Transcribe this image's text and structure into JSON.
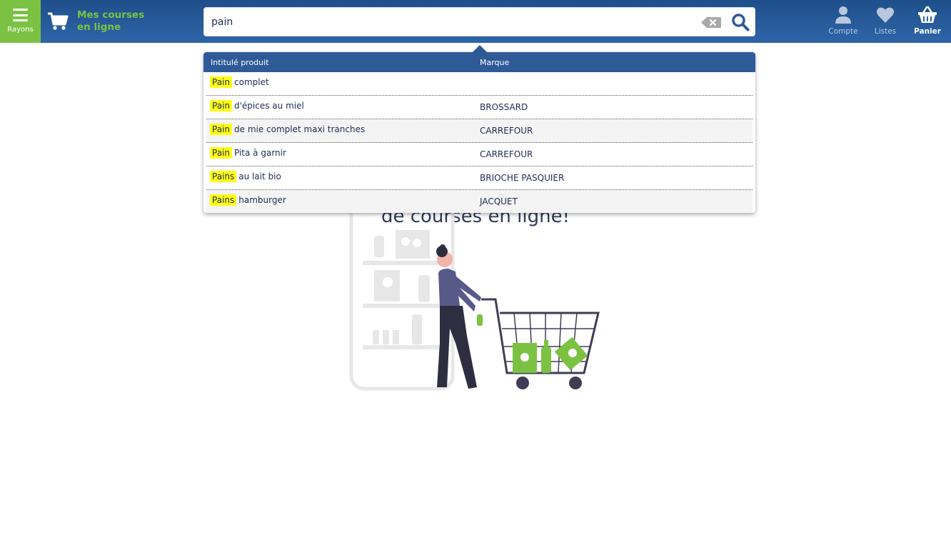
{
  "header": {
    "rayons_label": "Rayons",
    "logo_line1": "Mes courses",
    "logo_line2": "en ligne",
    "search": {
      "value": "pain",
      "placeholder": ""
    },
    "icons": [
      {
        "name": "user-icon",
        "label": "Compte"
      },
      {
        "name": "heart-icon",
        "label": "Listes"
      },
      {
        "name": "basket-icon",
        "label": "Panier"
      }
    ],
    "accent": "#7cc242",
    "bar_color": "#2e65a8"
  },
  "suggestions": {
    "col_product": "Intitulé produit",
    "col_brand": "Marque",
    "rows": [
      {
        "match": "Pain",
        "rest": "complet",
        "brand": ""
      },
      {
        "match": "Pain",
        "rest": "d'épices au miel",
        "brand": "BROSSARD"
      },
      {
        "match": "Pain",
        "rest": "de mie complet maxi tranches",
        "brand": "CARREFOUR"
      },
      {
        "match": "Pain",
        "rest": "Pita à garnir",
        "brand": "CARREFOUR"
      },
      {
        "match": "Pains",
        "rest": "au lait bio",
        "brand": "BRIOCHE PASQUIER"
      },
      {
        "match": "Pains",
        "rest": "hamburger",
        "brand": "JACQUET"
      }
    ],
    "highlight_color": "#ffff14"
  },
  "hero": {
    "title_visible": "de courses en ligne!"
  }
}
